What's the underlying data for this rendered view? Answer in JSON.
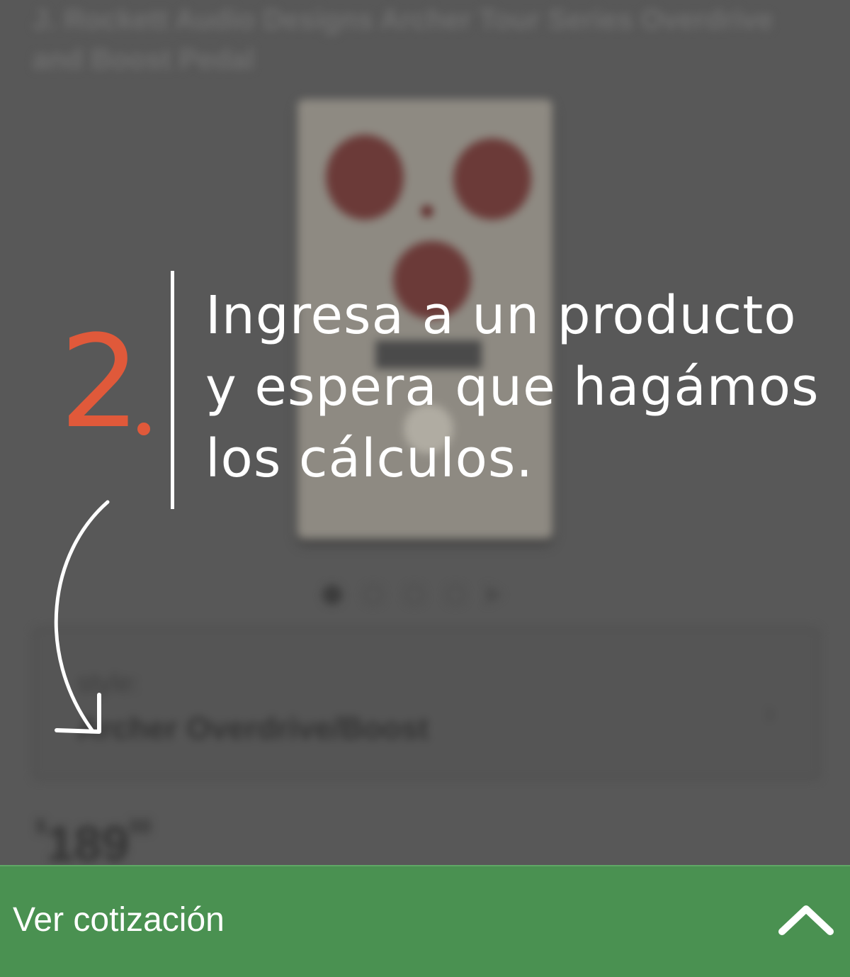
{
  "product": {
    "title": "J. Rockett Audio Designs Archer Tour Series Overdrive and Boost Pedal",
    "style_label": "style:",
    "style_value": "Archer Overdrive/Boost",
    "price_currency": "$",
    "price_integer": "189",
    "price_cents": "00",
    "carousel_pages": 4
  },
  "overlay": {
    "step_number": "2",
    "step_number_color": "#e0593a",
    "instruction": "Ingresa a un producto y espera que hagámos los cálculos."
  },
  "bottom_bar": {
    "label": "Ver cotización",
    "color": "#4a9151",
    "toggle_icon": "chevron-up-icon"
  }
}
